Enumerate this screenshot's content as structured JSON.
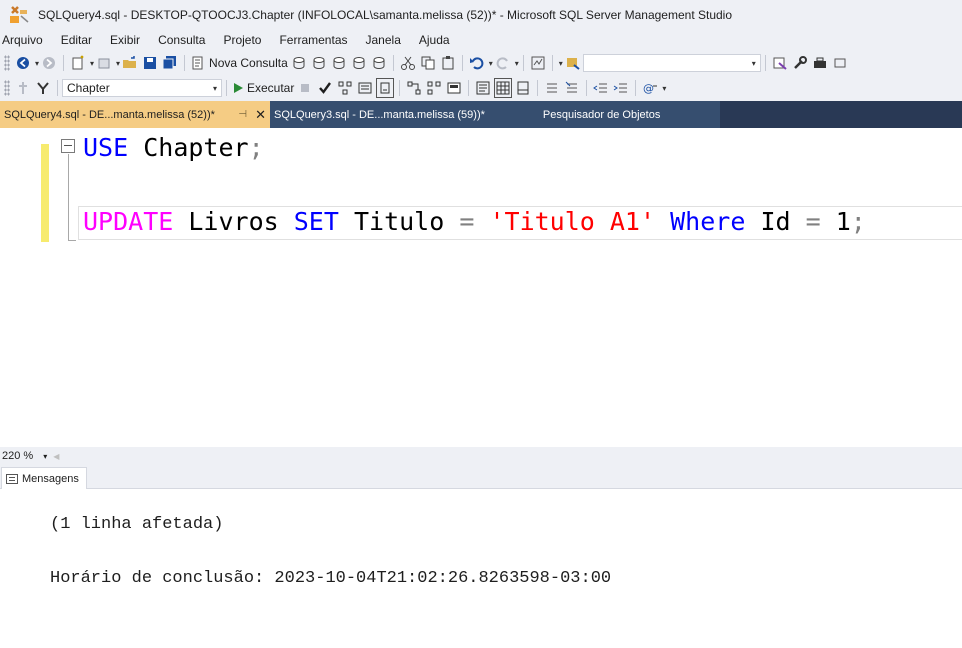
{
  "window": {
    "title": "SQLQuery4.sql - DESKTOP-QTOOCJ3.Chapter (INFOLOCAL\\samanta.melissa (52))* - Microsoft SQL Server Management Studio"
  },
  "menu": {
    "items": [
      "Arquivo",
      "Editar",
      "Exibir",
      "Consulta",
      "Projeto",
      "Ferramentas",
      "Janela",
      "Ajuda"
    ]
  },
  "toolbar1": {
    "new_query_label": "Nova Consulta"
  },
  "toolbar2": {
    "database": "Chapter",
    "execute_label": "Executar"
  },
  "tabs": {
    "active": "SQLQuery4.sql - DE...manta.melissa (52))*",
    "inactive": "SQLQuery3.sql - DE...manta.melissa (59))*",
    "explorer": "Pesquisador de Objetos"
  },
  "editor": {
    "line1": {
      "kw": "USE",
      "ident": "Chapter",
      "end": ";"
    },
    "line2": {
      "kw_update": "UPDATE",
      "table": "Livros",
      "kw_set": "SET",
      "column": "Titulo",
      "op_eq1": "=",
      "string": "'Titulo A1'",
      "kw_where": "Where",
      "id_col": "Id",
      "op_eq2": "=",
      "number": "1",
      "end": ";"
    }
  },
  "zoom": {
    "level": "220 %"
  },
  "results": {
    "tab_label": "Mensagens",
    "line1": "(1 linha afetada)",
    "line2": "Horário de conclusão: 2023-10-04T21:02:26.8263598-03:00"
  },
  "colors": {
    "active_tab": "#f5cc84",
    "tab_strip": "#293955",
    "keyword_blue": "#0000ff",
    "keyword_pink": "#ff00ff",
    "string_red": "#ff0000"
  }
}
